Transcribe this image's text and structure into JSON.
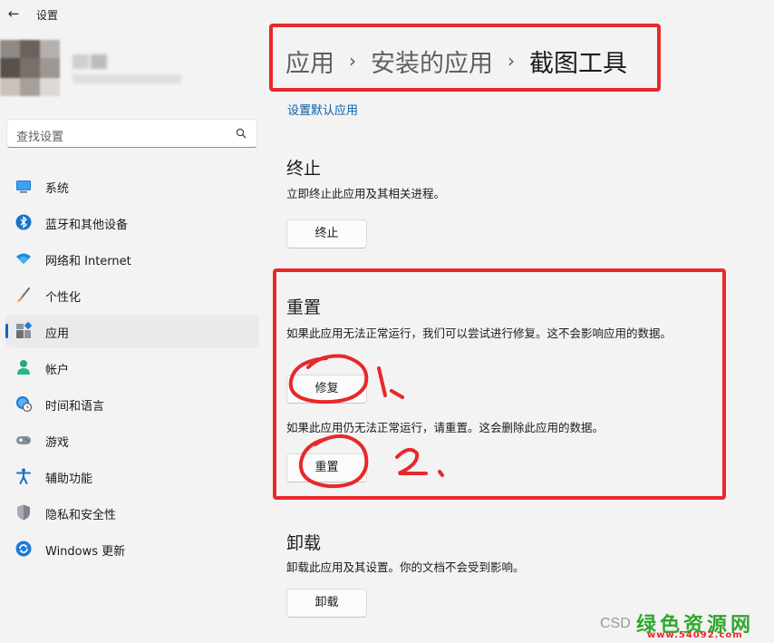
{
  "window": {
    "title": "设置"
  },
  "search": {
    "placeholder": "查找设置"
  },
  "sidebar": {
    "items": [
      {
        "label": "系统",
        "icon": "monitor-icon"
      },
      {
        "label": "蓝牙和其他设备",
        "icon": "bluetooth-icon"
      },
      {
        "label": "网络和 Internet",
        "icon": "wifi-icon"
      },
      {
        "label": "个性化",
        "icon": "brush-icon"
      },
      {
        "label": "应用",
        "icon": "apps-icon",
        "active": true
      },
      {
        "label": "帐户",
        "icon": "person-icon"
      },
      {
        "label": "时间和语言",
        "icon": "globe-clock-icon"
      },
      {
        "label": "游戏",
        "icon": "gamepad-icon"
      },
      {
        "label": "辅助功能",
        "icon": "accessibility-icon"
      },
      {
        "label": "隐私和安全性",
        "icon": "shield-icon"
      },
      {
        "label": "Windows 更新",
        "icon": "sync-icon"
      }
    ]
  },
  "breadcrumb": {
    "items": [
      "应用",
      "安装的应用",
      "截图工具"
    ]
  },
  "main": {
    "default_apps_link": "设置默认应用",
    "terminate": {
      "title": "终止",
      "desc": "立即终止此应用及其相关进程。",
      "button": "终止"
    },
    "reset": {
      "title": "重置",
      "repair_desc": "如果此应用无法正常运行，我们可以尝试进行修复。这不会影响应用的数据。",
      "repair_button": "修复",
      "reset_desc": "如果此应用仍无法正常运行，请重置。这会删除此应用的数据。",
      "reset_button": "重置"
    },
    "uninstall": {
      "title": "卸载",
      "desc": "卸载此应用及其设置。你的文档不会受到影响。",
      "button": "卸载"
    }
  },
  "annotations": {
    "step1": "1.",
    "step2": "2."
  },
  "watermark": {
    "prefix": "CSD",
    "brand": "绿色资源网",
    "url": "www.54092.com"
  },
  "colors": {
    "accent": "#0067c0",
    "annotation": "#e8282a",
    "watermark_green": "#2fa82e"
  }
}
